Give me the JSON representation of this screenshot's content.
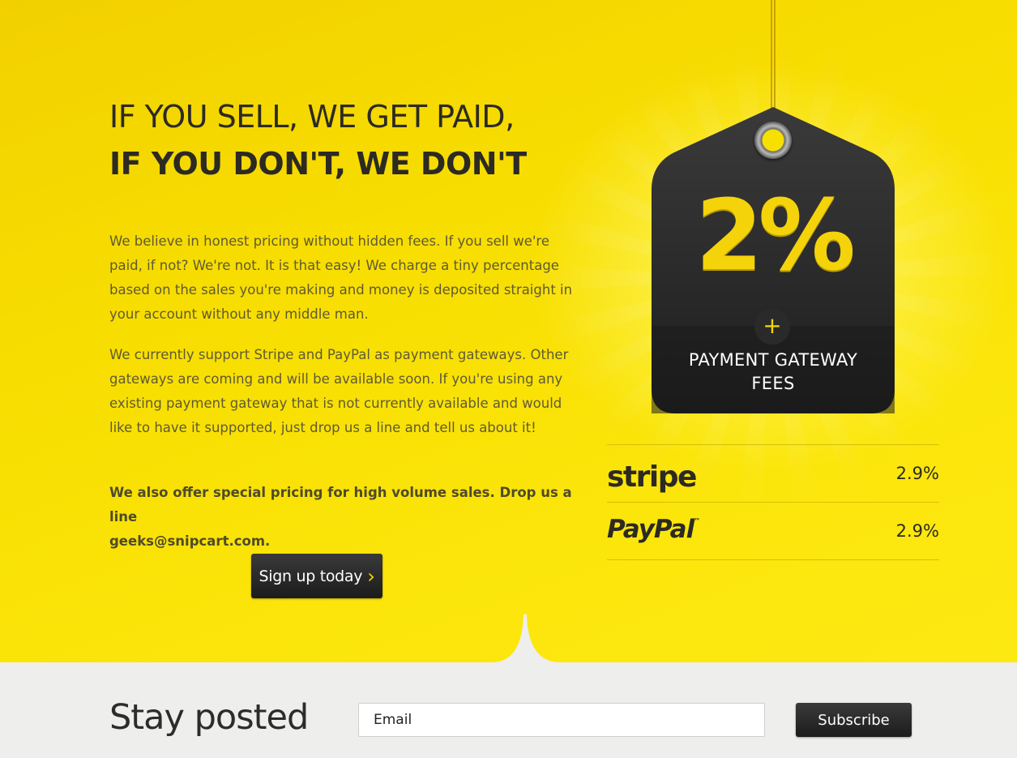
{
  "hero": {
    "heading_light": "IF YOU SELL, WE GET PAID,",
    "heading_bold": "IF YOU DON'T, WE DON'T",
    "paragraph_1": "We believe in honest pricing without hidden fees. If you sell we're paid, if not? We're not. It is that easy! We charge a tiny percentage based on the sales you're making and money is deposited straight in your account without any middle man.",
    "paragraph_2": "We currently support Stripe and PayPal as payment gateways. Other gateways are coming and will be available soon. If you're using any existing payment gateway that is not currently available and would like to have it supported, just drop us a line and tell us about it!",
    "paragraph_3_text": "We also offer special pricing for high volume sales. Drop us a line",
    "paragraph_3_email": "geeks@snipcart.com",
    "paragraph_3_end": ".",
    "signup_label": "Sign up today",
    "signup_chevron": "›"
  },
  "price_tag": {
    "percent": "2%",
    "plus": "+",
    "fees_line1": "PAYMENT GATEWAY",
    "fees_line2": "FEES",
    "accent_color": "#f4d30a",
    "tag_color": "#232323"
  },
  "gateways": [
    {
      "name": "stripe",
      "rate": "2.9%"
    },
    {
      "name": "PayPal",
      "trademark": "™",
      "rate": "2.9%"
    }
  ],
  "footer": {
    "title": "Stay posted",
    "email_placeholder": "Email",
    "subscribe_label": "Subscribe"
  },
  "colors": {
    "hero_yellow": "#f7dd00",
    "dark_button": "#232323",
    "footer_bg": "#eeeeec"
  }
}
